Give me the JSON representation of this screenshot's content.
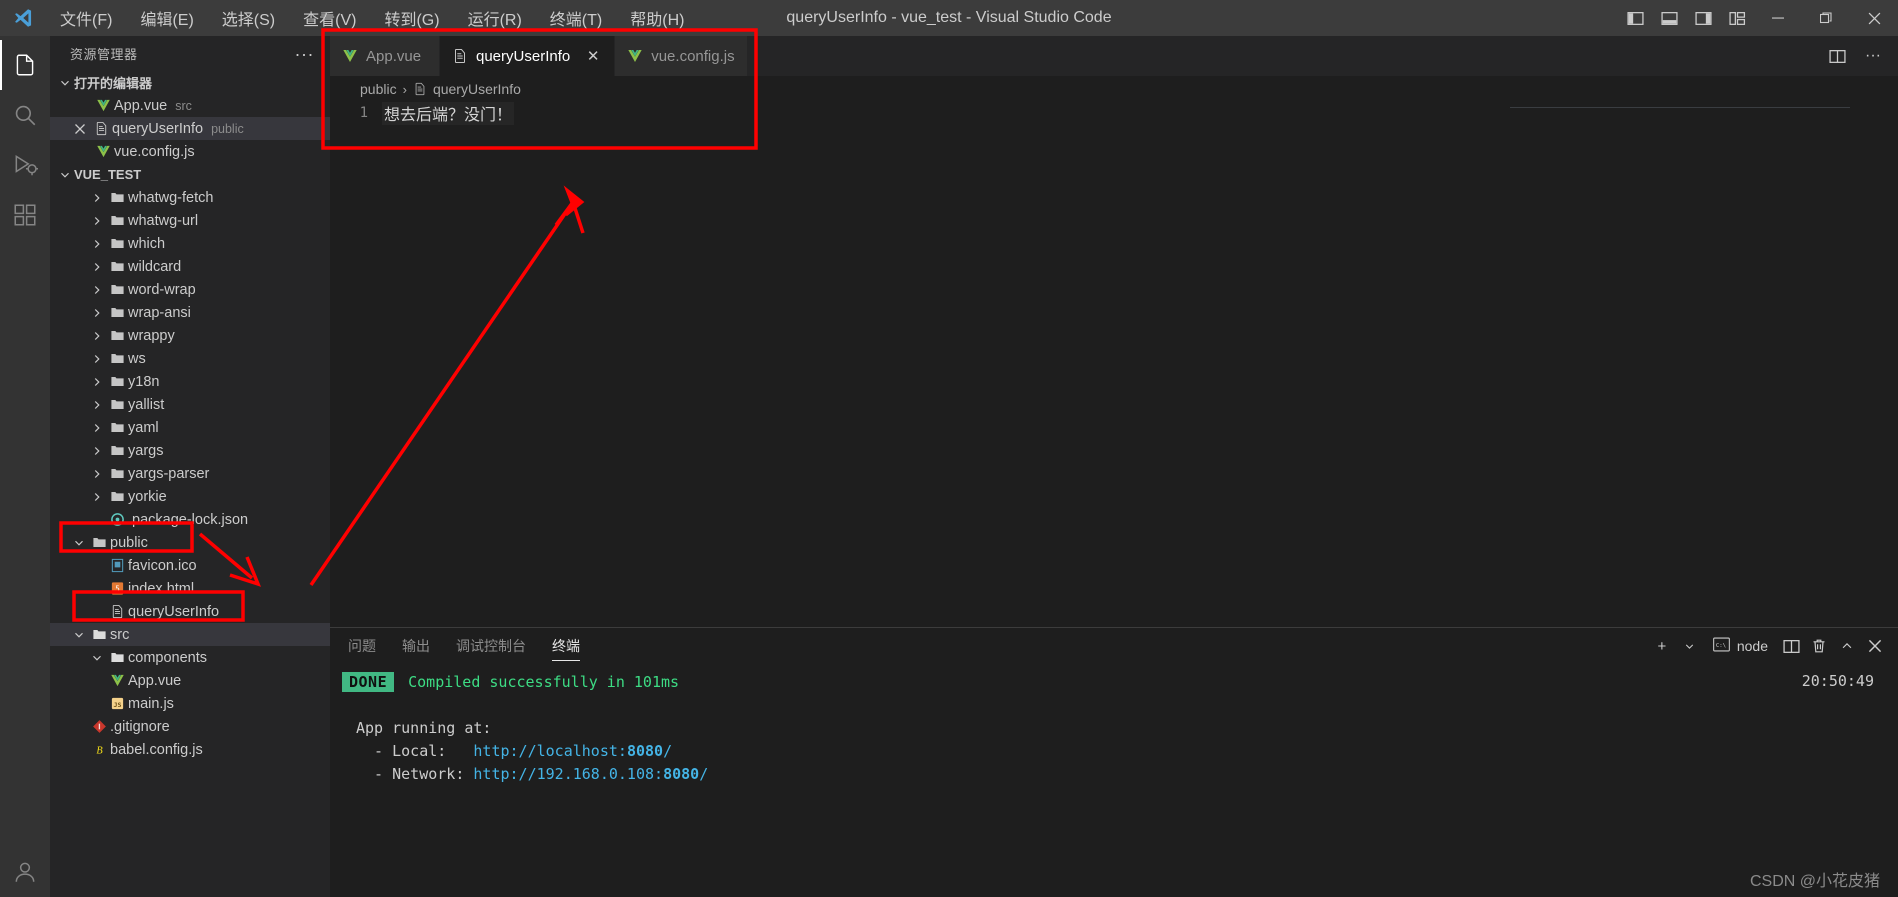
{
  "window": {
    "title": "queryUserInfo - vue_test - Visual Studio Code",
    "minimize": "—",
    "maximize": "❐",
    "close": "✕"
  },
  "menu": {
    "items": [
      {
        "label": "文件(F)"
      },
      {
        "label": "编辑(E)"
      },
      {
        "label": "选择(S)"
      },
      {
        "label": "查看(V)"
      },
      {
        "label": "转到(G)"
      },
      {
        "label": "运行(R)"
      },
      {
        "label": "终端(T)"
      },
      {
        "label": "帮助(H)"
      }
    ]
  },
  "activity_bar": {
    "items": [
      {
        "name": "explorer",
        "active": true
      },
      {
        "name": "search",
        "active": false
      },
      {
        "name": "run-debug",
        "active": false
      },
      {
        "name": "extensions",
        "active": false
      }
    ],
    "account": "accounts",
    "settings": "manage"
  },
  "sidebar": {
    "header": "资源管理器",
    "more_actions": "···",
    "open_editors": {
      "label": "打开的编辑器",
      "items": [
        {
          "name": "App.vue",
          "desc": "src",
          "icon": "vue-icon",
          "active": false,
          "dirty": false
        },
        {
          "name": "queryUserInfo",
          "desc": "public",
          "icon": "file-icon",
          "active": true,
          "dirty": false
        },
        {
          "name": "vue.config.js",
          "desc": "",
          "icon": "vue-icon",
          "active": false,
          "dirty": false
        }
      ]
    },
    "project": {
      "label": "VUE_TEST",
      "tree": [
        {
          "name": "whatwg-fetch",
          "type": "folder",
          "indent": 1,
          "expanded": false
        },
        {
          "name": "whatwg-url",
          "type": "folder",
          "indent": 1,
          "expanded": false
        },
        {
          "name": "which",
          "type": "folder",
          "indent": 1,
          "expanded": false
        },
        {
          "name": "wildcard",
          "type": "folder",
          "indent": 1,
          "expanded": false
        },
        {
          "name": "word-wrap",
          "type": "folder",
          "indent": 1,
          "expanded": false
        },
        {
          "name": "wrap-ansi",
          "type": "folder",
          "indent": 1,
          "expanded": false
        },
        {
          "name": "wrappy",
          "type": "folder",
          "indent": 1,
          "expanded": false
        },
        {
          "name": "ws",
          "type": "folder",
          "indent": 1,
          "expanded": false
        },
        {
          "name": "y18n",
          "type": "folder",
          "indent": 1,
          "expanded": false
        },
        {
          "name": "yallist",
          "type": "folder",
          "indent": 1,
          "expanded": false
        },
        {
          "name": "yaml",
          "type": "folder",
          "indent": 1,
          "expanded": false
        },
        {
          "name": "yargs",
          "type": "folder",
          "indent": 1,
          "expanded": false
        },
        {
          "name": "yargs-parser",
          "type": "folder",
          "indent": 1,
          "expanded": false
        },
        {
          "name": "yorkie",
          "type": "folder",
          "indent": 1,
          "expanded": false
        },
        {
          "name": ".package-lock.json",
          "type": "json",
          "indent": 1,
          "expanded": false
        },
        {
          "name": "public",
          "type": "folder",
          "indent": 0,
          "expanded": true,
          "highlight": true
        },
        {
          "name": "favicon.ico",
          "type": "ico",
          "indent": 1,
          "expanded": false
        },
        {
          "name": "index.html",
          "type": "html",
          "indent": 1,
          "expanded": false
        },
        {
          "name": "queryUserInfo",
          "type": "file",
          "indent": 1,
          "expanded": false,
          "highlight": true
        },
        {
          "name": "src",
          "type": "folder-open",
          "indent": 0,
          "expanded": true,
          "selected": true
        },
        {
          "name": "components",
          "type": "folder-open",
          "indent": 1,
          "expanded": true
        },
        {
          "name": "App.vue",
          "type": "vue",
          "indent": 1,
          "expanded": false
        },
        {
          "name": "main.js",
          "type": "js",
          "indent": 1,
          "expanded": false
        },
        {
          "name": ".gitignore",
          "type": "git",
          "indent": 0,
          "expanded": false
        },
        {
          "name": "babel.config.js",
          "type": "babel",
          "indent": 0,
          "expanded": false
        }
      ]
    }
  },
  "editor": {
    "tabs": [
      {
        "label": "App.vue",
        "icon": "vue-icon",
        "active": false,
        "closable": false
      },
      {
        "label": "queryUserInfo",
        "icon": "file-icon",
        "active": true,
        "closable": true,
        "close_glyph": "✕"
      },
      {
        "label": "vue.config.js",
        "icon": "vue-icon",
        "active": false,
        "closable": false
      }
    ],
    "actions": {
      "split_editor": "split-editor-icon",
      "more": "···"
    },
    "breadcrumb": {
      "folder": "public",
      "separator": "›",
      "file": "queryUserInfo"
    },
    "content": {
      "lines": [
        {
          "number": "1",
          "text": "想去后端？没门！"
        }
      ]
    }
  },
  "panel": {
    "tabs": [
      {
        "label": "问题",
        "active": false
      },
      {
        "label": "输出",
        "active": false
      },
      {
        "label": "调试控制台",
        "active": false
      },
      {
        "label": "终端",
        "active": true
      }
    ],
    "actions": {
      "new_terminal": "+",
      "new_terminal_dropdown": "⌄",
      "shell_label": "node",
      "split": "split-terminal-icon",
      "kill": "trash-icon",
      "collapse": "⌃",
      "close": "✕"
    },
    "terminal": {
      "clock": "20:50:49",
      "badge": "DONE",
      "status_line": "Compiled successfully in 101ms",
      "running_header": "App running at:",
      "local_label": "  - Local:   ",
      "local_url_prefix": "http://localhost:",
      "local_port": "8080",
      "local_suffix": "/",
      "network_label": "  - Network: ",
      "network_url_prefix": "http://192.168.0.108:",
      "network_port": "8080",
      "network_suffix": "/"
    }
  },
  "watermark": "CSDN @小花皮猪",
  "colors": {
    "accent_red": "#ff0000",
    "vue_green": "#41b883",
    "terminal_green": "#3ddc84",
    "link_blue": "#44b4e6"
  }
}
